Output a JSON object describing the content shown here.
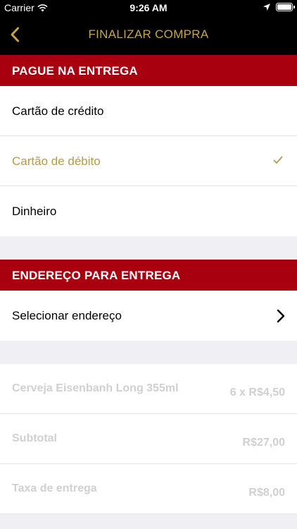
{
  "status_bar": {
    "carrier": "Carrier",
    "time": "9:26 AM"
  },
  "nav": {
    "title": "FINALIZAR COMPRA",
    "accent_color": "#c6a548"
  },
  "payment": {
    "header": "PAGUE NA ENTREGA",
    "options": [
      {
        "label": "Cartão de crédito",
        "selected": false
      },
      {
        "label": "Cartão de débito",
        "selected": true
      },
      {
        "label": "Dinheiro",
        "selected": false
      }
    ]
  },
  "address": {
    "header": "ENDEREÇO PARA ENTREGA",
    "select_label": "Selecionar endereço"
  },
  "summary": {
    "items": [
      {
        "label": "Cerveja Eisenbanh Long 355ml",
        "value": "6 x R$4,50"
      },
      {
        "label": "Subtotal",
        "value": "R$27,00"
      },
      {
        "label": "Taxa de entrega",
        "value": "R$8,00"
      }
    ]
  },
  "colors": {
    "header_red": "#a8000f",
    "selected_gold": "#b49a4a",
    "background": "#efeff4"
  }
}
